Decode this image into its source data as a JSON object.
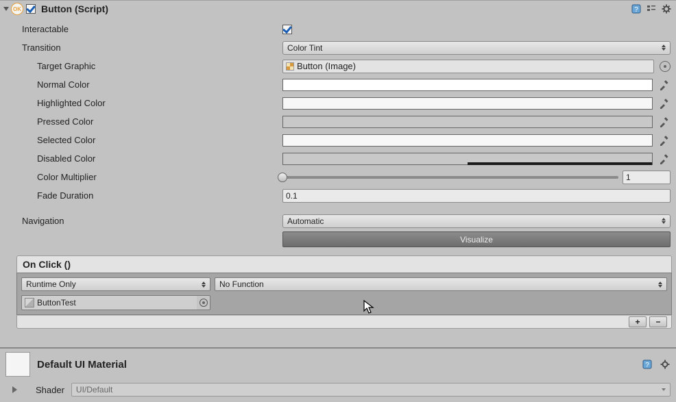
{
  "header": {
    "ok_badge": "OK",
    "title": "Button (Script)"
  },
  "fields": {
    "interactable_label": "Interactable",
    "transition_label": "Transition",
    "transition_value": "Color Tint",
    "target_graphic_label": "Target Graphic",
    "target_graphic_value": "Button (Image)",
    "normal_color_label": "Normal Color",
    "highlighted_color_label": "Highlighted Color",
    "pressed_color_label": "Pressed Color",
    "selected_color_label": "Selected Color",
    "disabled_color_label": "Disabled Color",
    "color_multiplier_label": "Color Multiplier",
    "color_multiplier_value": "1",
    "fade_duration_label": "Fade Duration",
    "fade_duration_value": "0.1",
    "navigation_label": "Navigation",
    "navigation_value": "Automatic",
    "visualize_label": "Visualize"
  },
  "event": {
    "header": "On Click ()",
    "runtime_value": "Runtime Only",
    "function_value": "No Function",
    "object_value": "ButtonTest",
    "plus": "+",
    "minus": "−"
  },
  "material": {
    "title": "Default UI Material",
    "shader_label": "Shader",
    "shader_value": "UI/Default"
  }
}
